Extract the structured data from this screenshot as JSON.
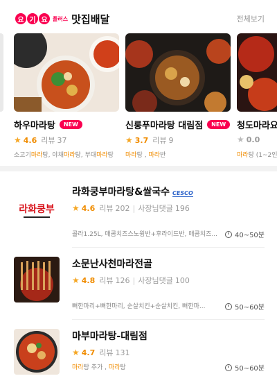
{
  "header": {
    "logo_letters": [
      "요",
      "기",
      "요"
    ],
    "logo_plus": "플러스",
    "title": "맛집배달",
    "see_all": "전체보기"
  },
  "featured": [
    {
      "name": "하우마라탕",
      "badge": "NEW",
      "rating": "4.6",
      "review_label": "리뷰",
      "reviews": "37",
      "tags": [
        "소고기",
        "마라",
        "탕, 야채",
        "마라",
        "탕, 부대",
        "마라",
        "탕"
      ]
    },
    {
      "name": "신룽푸마라탕 대림점",
      "badge": "NEW",
      "rating": "3.7",
      "review_label": "리뷰",
      "reviews": "9",
      "tags": [
        "마라",
        "탕 , ",
        "마라",
        "반"
      ]
    },
    {
      "name": "청도마라요",
      "badge": "",
      "rating": "0.0",
      "review_label": "",
      "reviews": "",
      "tags": [
        "마라",
        "탕 (1~2인"
      ]
    }
  ],
  "list": [
    {
      "name": "라화쿵부마라탕&쌀국수",
      "extra_badge": "CESCO",
      "rating": "4.6",
      "review_label": "리뷰",
      "reviews": "202",
      "owner_label": "사장님댓글",
      "owner_replies": "196",
      "menu": "콜라1.25L, 매콤치즈스노윙반+후라이드반, 매콤치즈...",
      "time": "40~50분",
      "logo_text": "라화쿵부"
    },
    {
      "name": "소문난사천마라전골",
      "extra_badge": "",
      "rating": "4.8",
      "review_label": "리뷰",
      "reviews": "126",
      "owner_label": "사장님댓글",
      "owner_replies": "100",
      "menu": "뼈한마리+뼈한마리, 순살치킨+순살치킨, 뼈한마...",
      "time": "50~60분",
      "logo_text": ""
    },
    {
      "name": "마부마라탕-대림점",
      "extra_badge": "",
      "rating": "4.7",
      "review_label": "리뷰",
      "reviews": "131",
      "owner_label": "",
      "owner_replies": "",
      "menu_parts": [
        "마라",
        "탕 추가 , ",
        "마라",
        "탕"
      ],
      "time": "50~60분",
      "logo_text": ""
    }
  ],
  "colors": {
    "brand": "#fa0050",
    "accent": "#f08c00",
    "star": "#f5a623"
  },
  "icons": [
    "star-icon",
    "clock-icon"
  ]
}
